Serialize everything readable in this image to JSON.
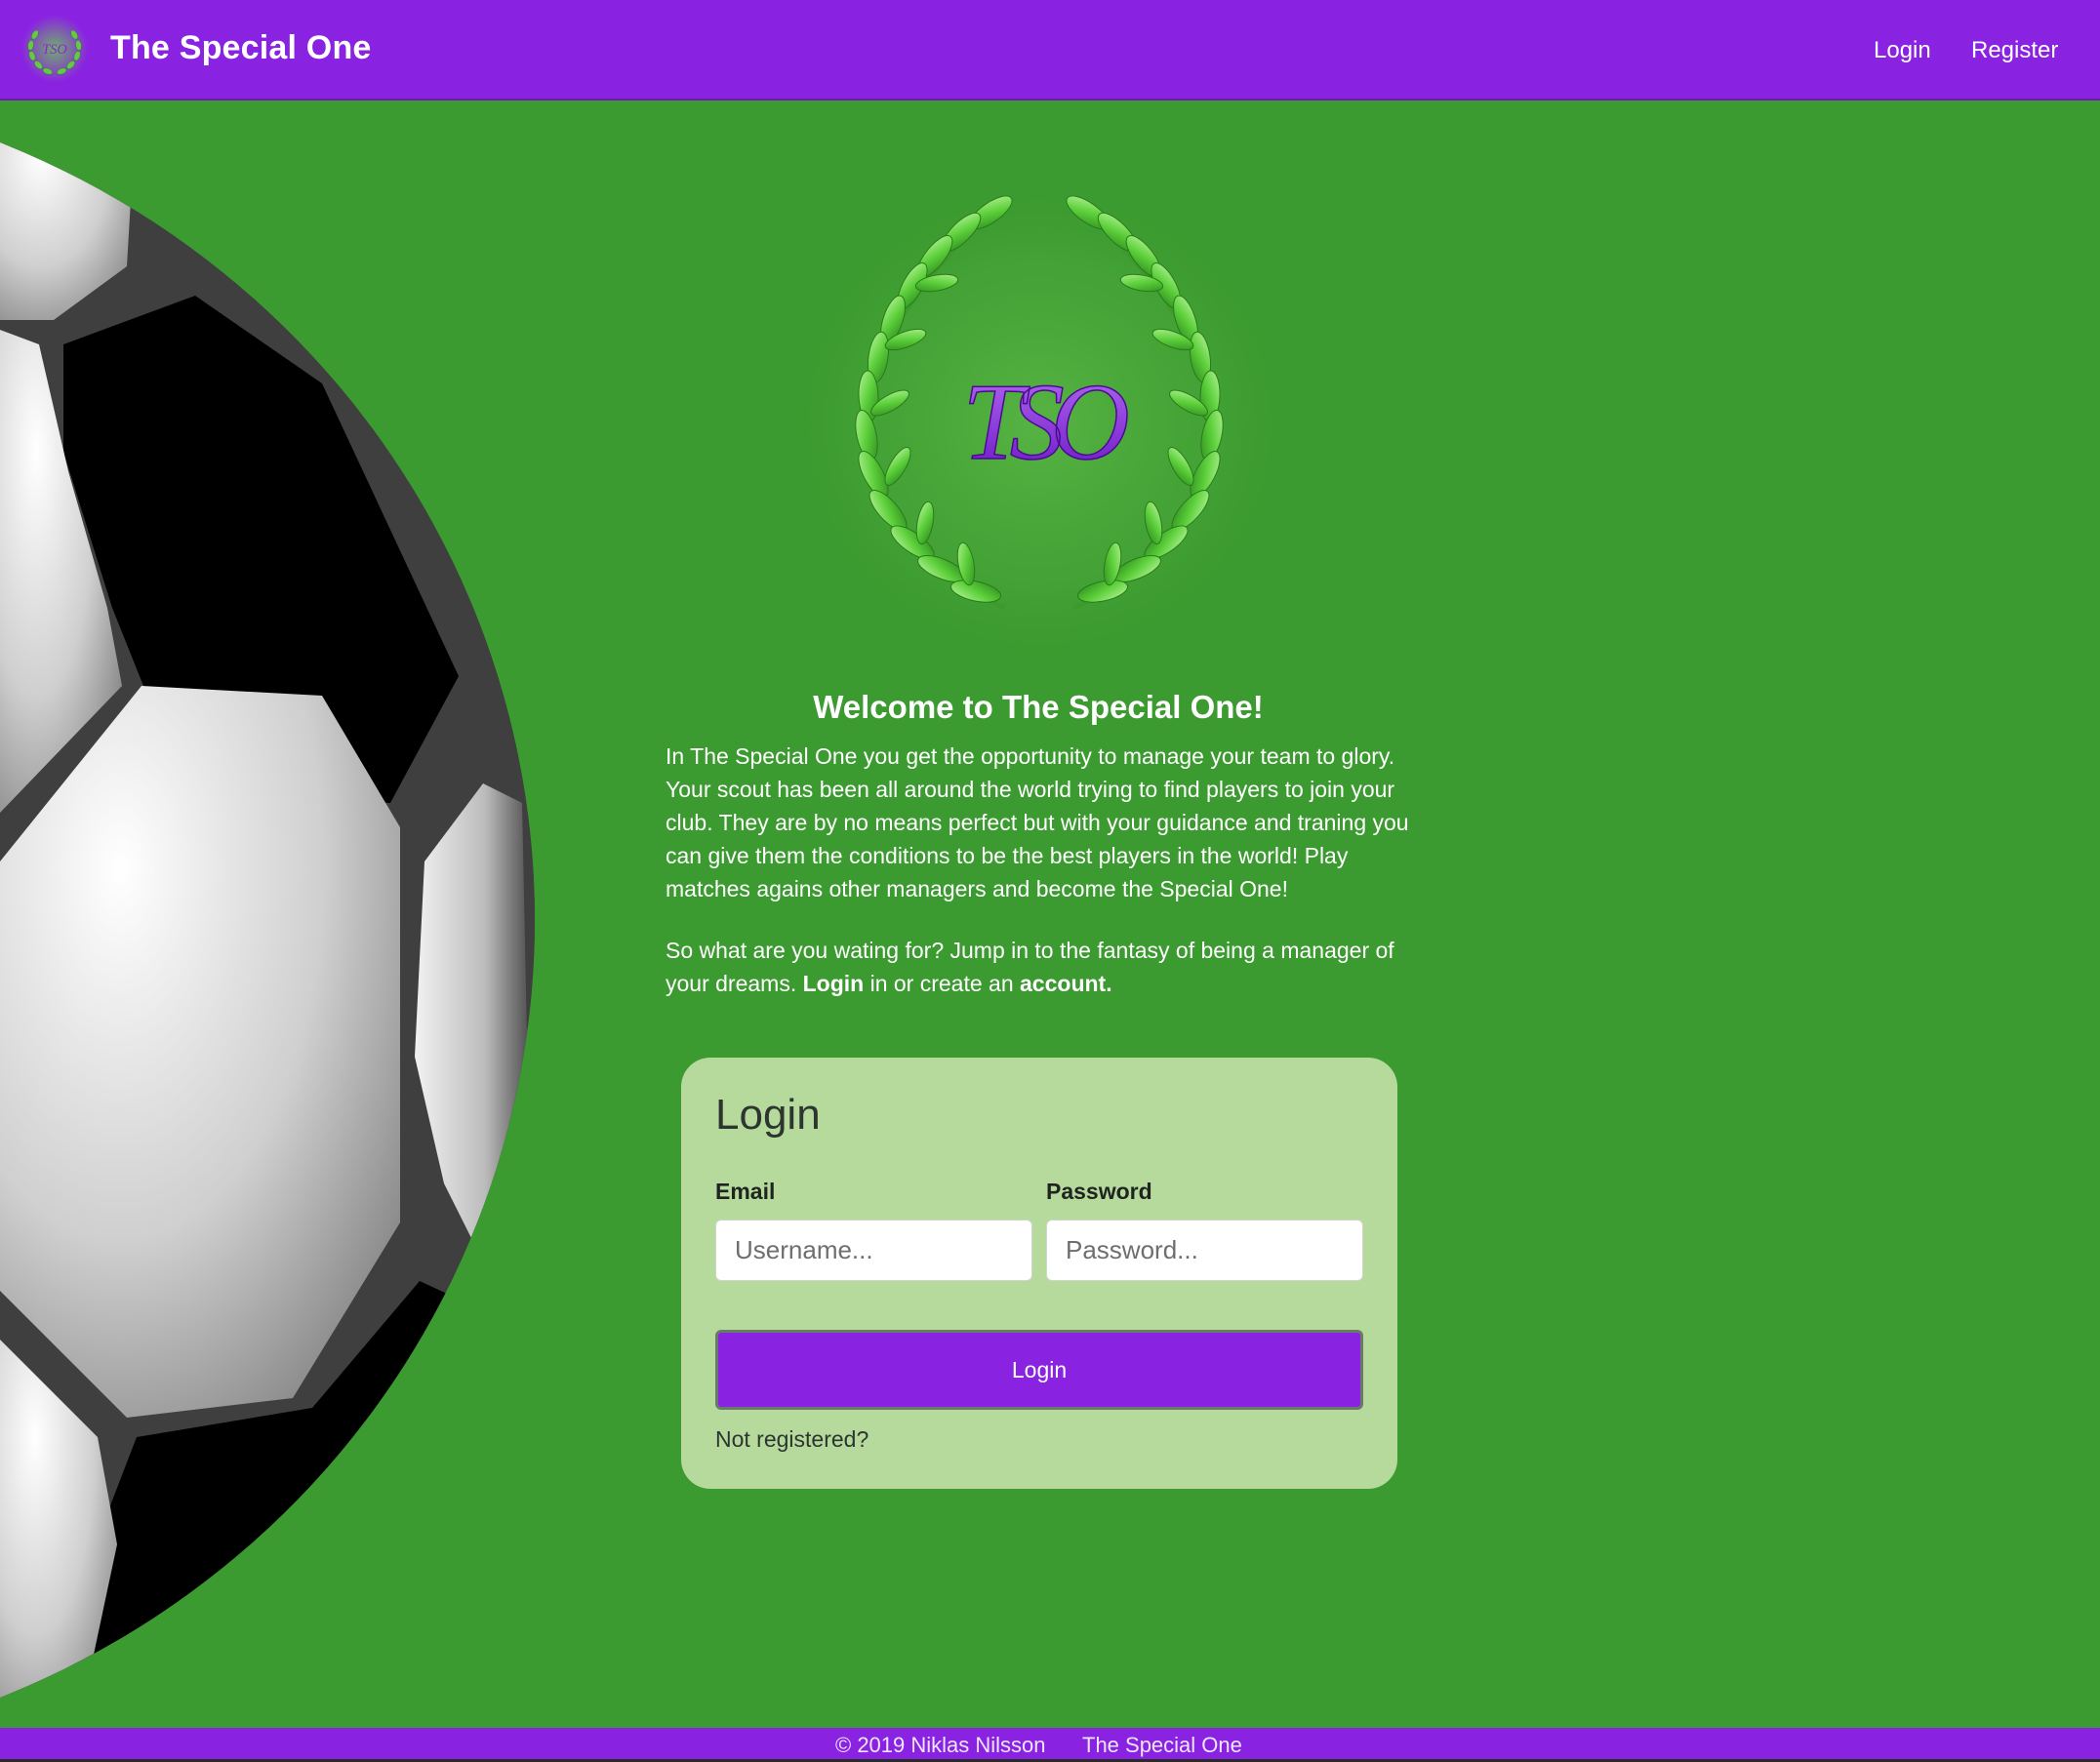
{
  "navbar": {
    "brand_title": "The Special One",
    "logo_monogram": "TSO",
    "links": {
      "login": "Login",
      "register": "Register"
    }
  },
  "hero": {
    "logo_monogram": "TSO",
    "welcome": "Welcome to The Special One!",
    "intro": "In The Special One you get the opportunity to manage your team to glory. Your scout has been all around the world trying to find players to join your club. They are by no means perfect but with your guidance and traning you can give them the conditions to be the best players in the world! Play matches agains other managers and become the Special One!",
    "cta_prefix": "So what are you wating for? Jump in to the fantasy of being a manager of your dreams. ",
    "cta_login_link": "Login",
    "cta_middle": " in or create an ",
    "cta_account_link": "account."
  },
  "login_form": {
    "title": "Login",
    "email_label": "Email",
    "email_placeholder": "Username...",
    "password_label": "Password",
    "password_placeholder": "Password...",
    "submit_label": "Login",
    "not_registered": "Not registered?"
  },
  "footer": {
    "copyright": "© 2019 Niklas Nilsson",
    "brand": "The Special One"
  },
  "colors": {
    "primary_purple": "#8a22e2",
    "background_green": "#3c9b30",
    "card_green": "#b5da9c"
  }
}
